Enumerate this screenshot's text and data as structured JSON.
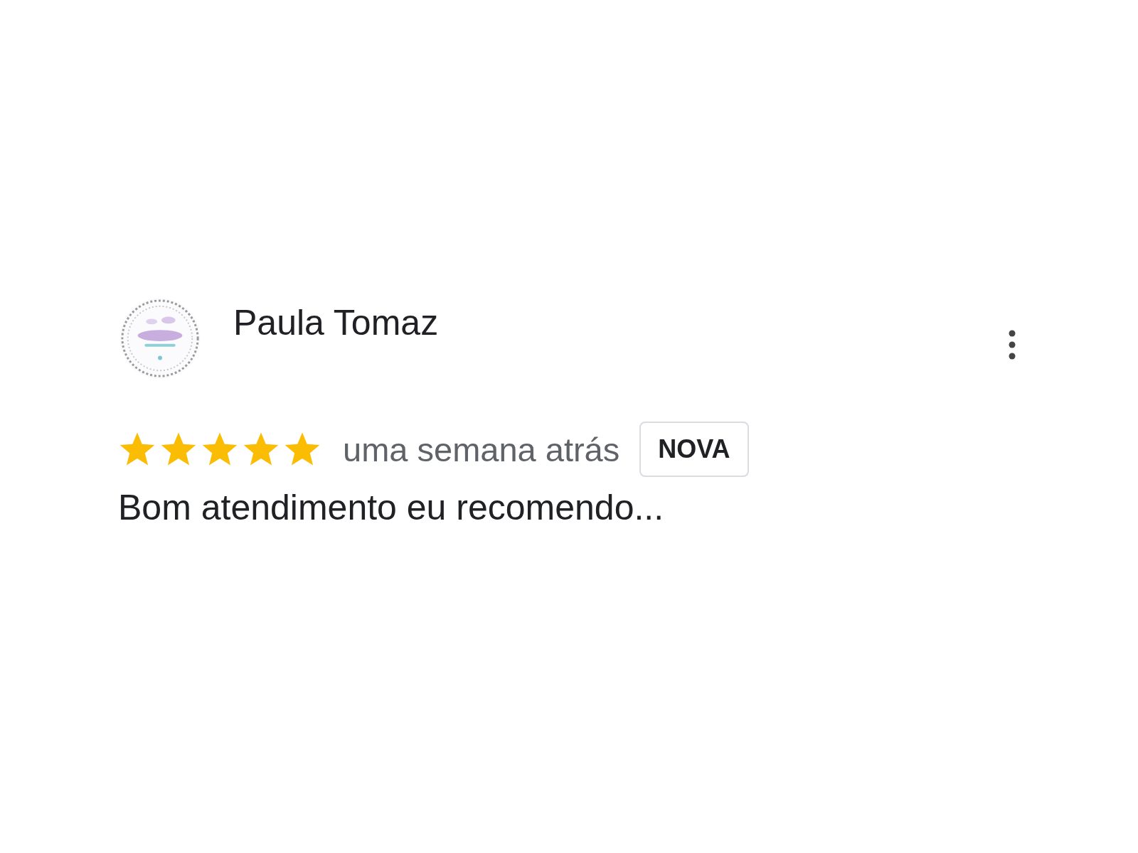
{
  "review": {
    "author": "Paula Tomaz",
    "stars": 5,
    "time": "uma semana atrás",
    "badge": "NOVA",
    "text": "Bom atendimento eu recomendo..."
  }
}
